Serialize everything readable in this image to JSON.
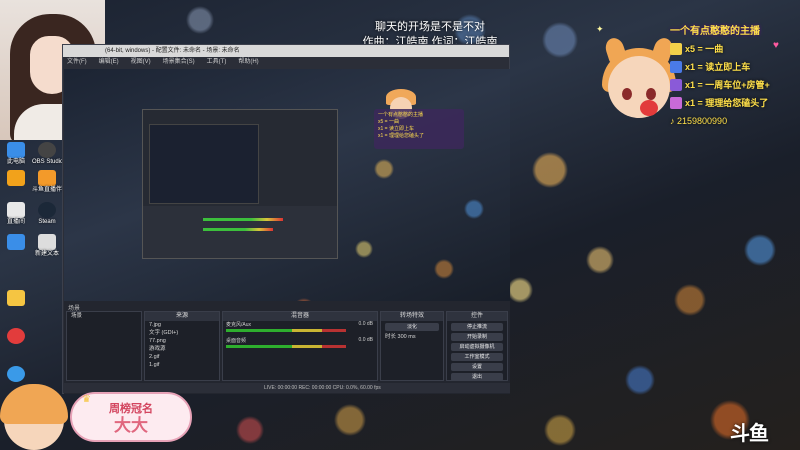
{
  "song": {
    "line1": "聊天的开场是不是不对",
    "line2": "作曲：江皓南 作词：江皓南"
  },
  "desktop_icons": [
    {
      "label": "此电脑",
      "color": "#3a8ee8"
    },
    {
      "label": "OBS Studio",
      "color": "#444444"
    },
    {
      "label": "",
      "color": "#f2a21b"
    },
    {
      "label": "斗鱼直播伴侣",
      "color": "#f39a2a"
    },
    {
      "label": "直播间",
      "color": "#e8e8e8"
    },
    {
      "label": "Steam",
      "color": "#1b2838"
    },
    {
      "label": "",
      "color": "#3a8ee8"
    },
    {
      "label": "新建文本",
      "color": "#dddddd"
    },
    {
      "label": "",
      "color": "#f5c542"
    },
    {
      "label": "",
      "color": "#e23c3c"
    },
    {
      "label": "",
      "color": "#3a9ae8"
    },
    {
      "label": "",
      "color": "#dd3333"
    }
  ],
  "obs": {
    "title": "(64-bit, windows) - 配置文件: 未命名 - 场景: 未命名",
    "menu": [
      "文件(F)",
      "编辑(E)",
      "视图(V)",
      "场景集合(S)",
      "工具(T)",
      "帮助(H)"
    ],
    "docks": {
      "scenes_label": "场景",
      "sources_label": "来源",
      "mixer_label": "混音器",
      "transitions_label": "转场特效",
      "controls_label": "控件",
      "scene_items": [
        "场景"
      ],
      "sources": [
        "7.jpg",
        "文字 (GDI+)",
        "77.png",
        "游戏源",
        "2.gif",
        "1.gif"
      ],
      "mixer": [
        {
          "name": "麦克风/Aux",
          "db": "0.0 dB"
        },
        {
          "name": "桌面音频",
          "db": "0.0 dB"
        }
      ],
      "transition": {
        "type": "淡化",
        "duration_label": "时长",
        "duration": "300 ms"
      },
      "controls": [
        "停止推流",
        "开始录制",
        "启动虚拟摄像机",
        "工作室模式",
        "设置",
        "退出"
      ]
    },
    "status": "LIVE: 00:00:00   REC: 00:00:00   CPU: 0.0%, 60.00 fps"
  },
  "overlay": {
    "title": "一个有点憨憨的主播",
    "rows": [
      {
        "text": "x5 = 一曲",
        "icon_color": "#f2d14a"
      },
      {
        "text": "x1 = 读立即上车",
        "icon_color": "#4a7ae8"
      },
      {
        "text": "x1 = 一周车位+房管+",
        "icon_color": "#8a5ad8"
      },
      {
        "text": "x1 = 理理给您磕头了",
        "icon_color": "#c86ad8"
      }
    ],
    "number": "2159800990"
  },
  "badge": {
    "top": "周榜冠名",
    "bottom": "大大"
  },
  "logo": "斗鱼"
}
